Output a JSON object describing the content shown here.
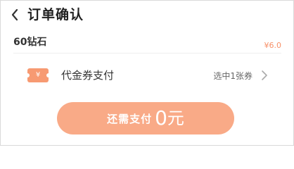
{
  "header": {
    "title": "订单确认",
    "back_icon": "chevron-left-icon"
  },
  "order_item": {
    "name": "60钻石",
    "price": "¥6.0"
  },
  "coupon": {
    "icon": "coupon-ticket-icon",
    "icon_symbol": "¥",
    "label": "代金券支付",
    "status": "选中1张券",
    "arrow_icon": "chevron-right-icon"
  },
  "pay_button": {
    "label": "还需支付",
    "amount": "0",
    "unit": "元"
  },
  "colors": {
    "accent": "#f9aa87",
    "price": "#f79068",
    "coupon_icon": "#f79a72"
  }
}
